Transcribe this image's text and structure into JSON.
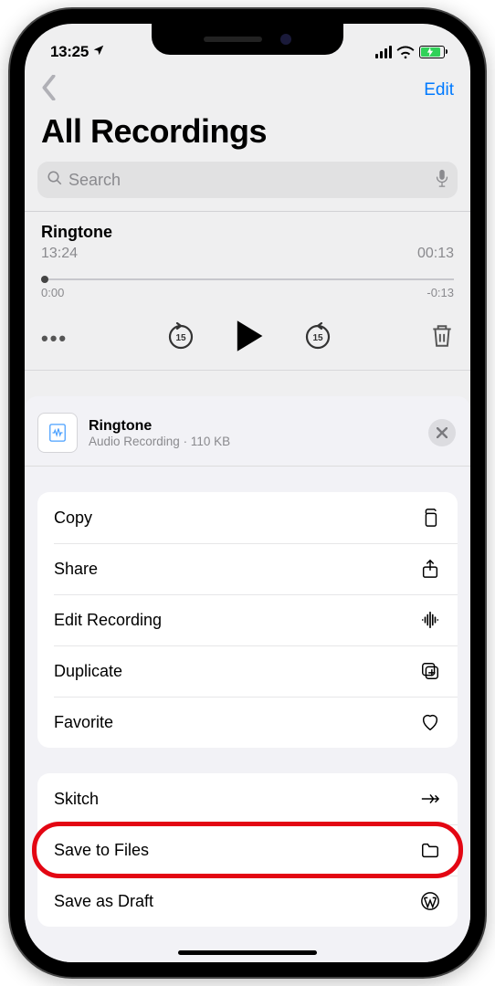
{
  "status": {
    "time": "13:25"
  },
  "nav": {
    "edit": "Edit"
  },
  "page": {
    "title": "All Recordings"
  },
  "search": {
    "placeholder": "Search"
  },
  "recording": {
    "title": "Ringtone",
    "timestamp": "13:24",
    "duration": "00:13",
    "scrub_start": "0:00",
    "scrub_end": "-0:13"
  },
  "share": {
    "file_name": "Ringtone",
    "file_subtitle": "Audio Recording · 110 KB"
  },
  "actions_group1": [
    {
      "label": "Copy"
    },
    {
      "label": "Share"
    },
    {
      "label": "Edit Recording"
    },
    {
      "label": "Duplicate"
    },
    {
      "label": "Favorite"
    }
  ],
  "actions_group2": [
    {
      "label": "Skitch"
    },
    {
      "label": "Save to Files"
    },
    {
      "label": "Save as Draft"
    }
  ]
}
